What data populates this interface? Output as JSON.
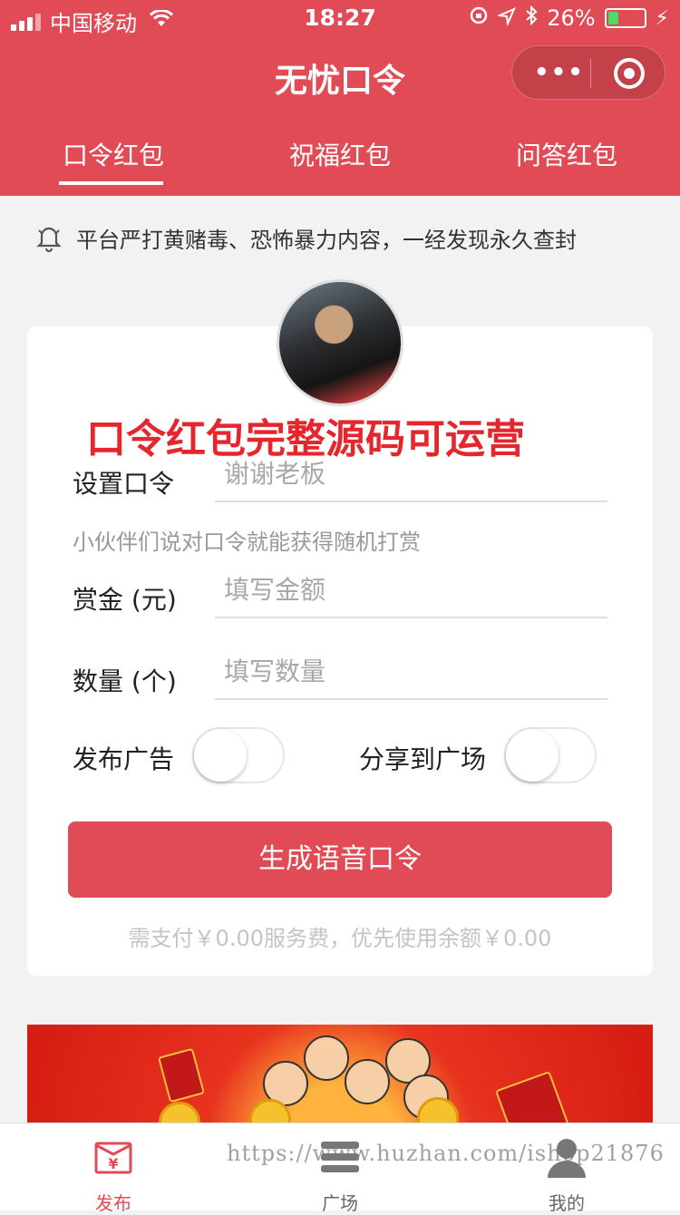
{
  "status_bar": {
    "carrier": "中国移动",
    "time": "18:27",
    "battery": "26%"
  },
  "nav": {
    "title": "无忧口令",
    "menu_dots": "•••"
  },
  "tabs": [
    {
      "label": "口令红包",
      "active": true
    },
    {
      "label": "祝福红包",
      "active": false
    },
    {
      "label": "问答红包",
      "active": false
    }
  ],
  "notice": {
    "text": "平台严打黄赌毒、恐怖暴力内容，一经发现永久查封"
  },
  "promo_text": "口令红包完整源码可运营",
  "form": {
    "password": {
      "label": "设置口令",
      "placeholder": "谢谢老板"
    },
    "hint": "小伙伴们说对口令就能获得随机打赏",
    "amount": {
      "label": "赏金 (元)",
      "placeholder": "填写金额"
    },
    "quantity": {
      "label": "数量 (个)",
      "placeholder": "填写数量"
    },
    "publish_ad": {
      "label": "发布广告",
      "on": false
    },
    "share_square": {
      "label": "分享到广场",
      "on": false
    },
    "submit_label": "生成语音口令",
    "pay_note": "需支付￥0.00服务费，优先使用余额￥0.00"
  },
  "watermark": "https://www.huzhan.com/ishop21876",
  "tabbar": [
    {
      "label": "发布",
      "icon": "envelope-yen-icon",
      "active": true
    },
    {
      "label": "广场",
      "icon": "list-icon",
      "active": false
    },
    {
      "label": "我的",
      "icon": "person-icon",
      "active": false
    }
  ],
  "colors": {
    "brand": "#e04b55",
    "promo": "#e5262c"
  }
}
